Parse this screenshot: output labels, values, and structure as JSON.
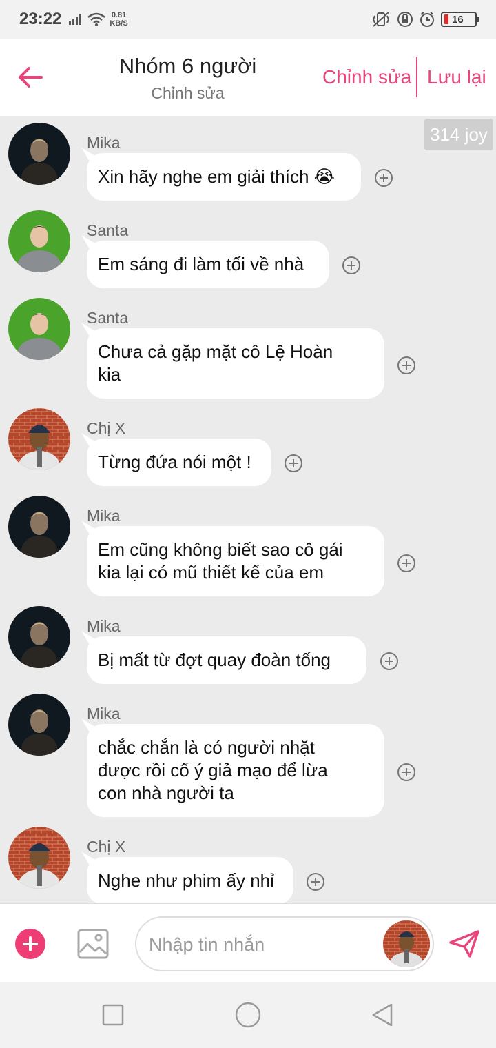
{
  "status_bar": {
    "time": "23:22",
    "net_speed_value": "0.81",
    "net_speed_unit": "KB/S",
    "battery_level": "16"
  },
  "header": {
    "title": "Nhóm 6 người",
    "subtitle": "Chỉnh sửa",
    "edit_label": "Chỉnh sửa",
    "save_label": "Lưu lại",
    "accent_color": "#e8457b"
  },
  "badge": "314 joy",
  "messages": [
    {
      "sender": "Mika",
      "text": "Xin hãy nghe em giải thích 😭"
    },
    {
      "sender": "Santa",
      "text": "Em sáng đi làm tối về nhà"
    },
    {
      "sender": "Santa",
      "text": "Chưa cả gặp mặt cô Lệ Hoàn\nkia"
    },
    {
      "sender": "Chị X",
      "text": "Từng đứa nói một !"
    },
    {
      "sender": "Mika",
      "text": "Em cũng không biết sao cô gái\nkia lại có mũ thiết kế của em"
    },
    {
      "sender": "Mika",
      "text": " Bị mất từ đợt quay đoàn tống"
    },
    {
      "sender": "Mika",
      "text": "chắc chắn  là có người nhặt\nđược rồi cố ý giả mạo để lừa\ncon nhà người ta"
    },
    {
      "sender": "Chị X",
      "text": "Nghe như phim ấy nhỉ"
    }
  ],
  "input": {
    "placeholder": "Nhập tin nhắn"
  },
  "icons": {
    "back": "arrow-left-icon",
    "add_reaction": "plus-circle-icon",
    "plus": "plus-icon",
    "image": "image-icon",
    "send": "send-icon"
  }
}
